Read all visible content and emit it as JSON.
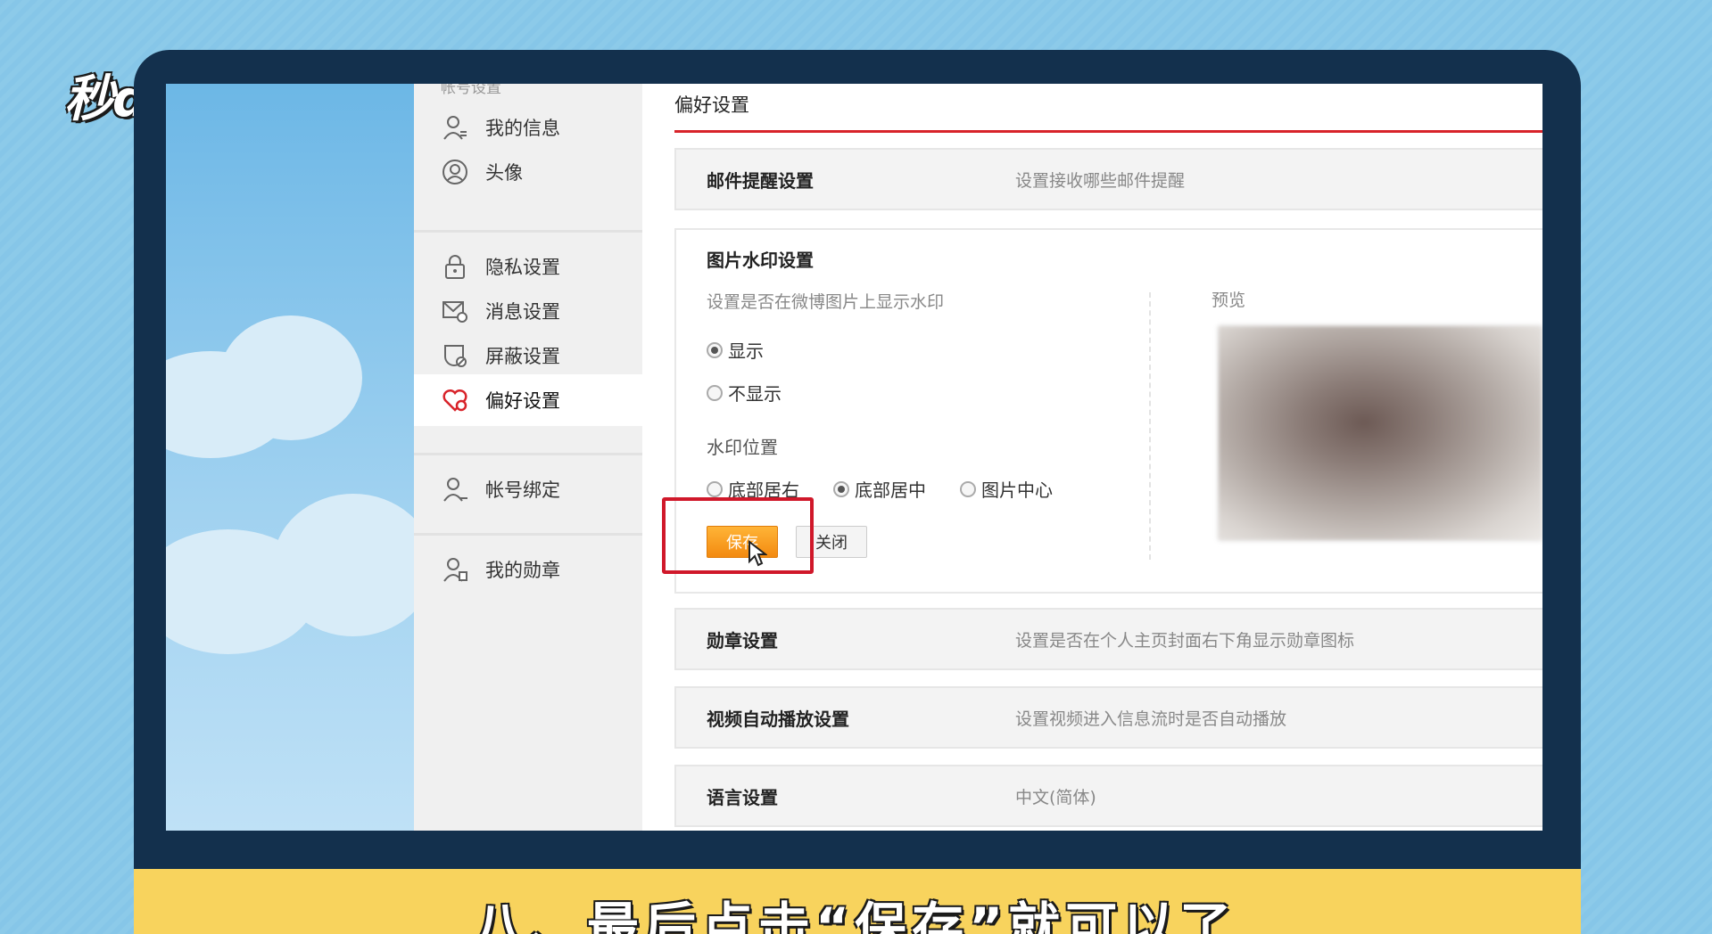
{
  "logo": {
    "text": "秒dong视频"
  },
  "sidebar": {
    "section_title": "帐号设置",
    "items": [
      {
        "label": "我的信息",
        "icon": "user-icon"
      },
      {
        "label": "头像",
        "icon": "avatar-icon"
      },
      {
        "label": "隐私设置",
        "icon": "lock-icon"
      },
      {
        "label": "消息设置",
        "icon": "message-settings-icon"
      },
      {
        "label": "屏蔽设置",
        "icon": "block-icon"
      },
      {
        "label": "偏好设置",
        "icon": "heart-settings-icon",
        "active": true
      },
      {
        "label": "帐号绑定",
        "icon": "account-bind-icon"
      },
      {
        "label": "我的勋章",
        "icon": "medal-icon"
      }
    ]
  },
  "main": {
    "title": "偏好设置",
    "email_row": {
      "name": "邮件提醒设置",
      "desc": "设置接收哪些邮件提醒"
    },
    "watermark": {
      "title": "图片水印设置",
      "desc": "设置是否在微博图片上显示水印",
      "show_options": [
        {
          "label": "显示",
          "checked": true
        },
        {
          "label": "不显示",
          "checked": false
        }
      ],
      "position_label": "水印位置",
      "position_options": [
        {
          "label": "底部居右",
          "checked": false
        },
        {
          "label": "底部居中",
          "checked": true
        },
        {
          "label": "图片中心",
          "checked": false
        }
      ],
      "save_label": "保存",
      "close_label": "关闭",
      "preview_label": "预览"
    },
    "medal_row": {
      "name": "勋章设置",
      "desc": "设置是否在个人主页封面右下角显示勋章图标"
    },
    "video_row": {
      "name": "视频自动播放设置",
      "desc": "设置视频进入信息流时是否自动播放"
    },
    "language_row": {
      "name": "语言设置",
      "desc": "中文(简体)"
    }
  },
  "caption": {
    "text": "八、最后点击“保存”就可以了"
  },
  "colors": {
    "accent_red": "#d8232a",
    "save_orange": "#f38a10",
    "caption_yellow": "#f8d35d",
    "frame": "#13304d"
  }
}
